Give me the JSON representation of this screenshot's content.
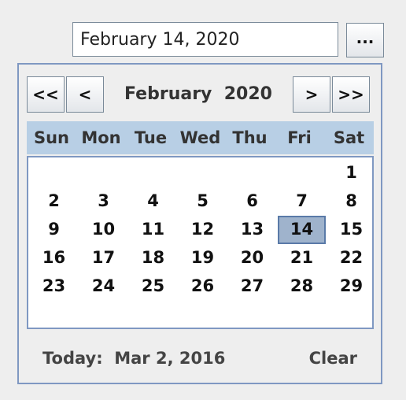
{
  "date_field": {
    "value": "February 14, 2020"
  },
  "picker_button": {
    "label": "..."
  },
  "navigation": {
    "prev_year_label": "<<",
    "prev_month_label": "<",
    "month_year_label": "February  2020",
    "next_month_label": ">",
    "next_year_label": ">>"
  },
  "weekdays": [
    "Sun",
    "Mon",
    "Tue",
    "Wed",
    "Thu",
    "Fri",
    "Sat"
  ],
  "calendar": {
    "first_weekday_index": 6,
    "days_in_month": 29,
    "selected_day": 14,
    "day_labels": [
      "1",
      "2",
      "3",
      "4",
      "5",
      "6",
      "7",
      "8",
      "9",
      "10",
      "11",
      "12",
      "13",
      "14",
      "15",
      "16",
      "17",
      "18",
      "19",
      "20",
      "21",
      "22",
      "23",
      "24",
      "25",
      "26",
      "27",
      "28",
      "29"
    ]
  },
  "footer": {
    "today_label": "Today:  Mar 2, 2016",
    "clear_label": "Clear"
  },
  "colors": {
    "header_background": "#b8cfe5",
    "selected_background": "#9fb3cc",
    "border": "#7f98c2"
  }
}
